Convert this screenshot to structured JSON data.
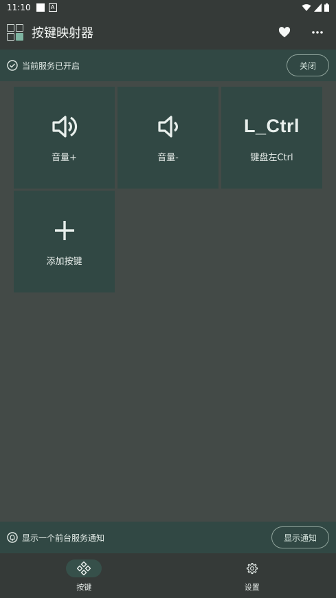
{
  "status": {
    "time": "11:10",
    "notification_letter": "A"
  },
  "app": {
    "title": "按键映射器",
    "icons": {
      "logo": "app-logo-icon",
      "favorite": "heart-icon",
      "more": "more-horiz-icon"
    }
  },
  "service": {
    "status_text": "当前服务已开启",
    "close_label": "关闭",
    "icon": "check-circle-icon"
  },
  "keys": [
    {
      "icon": "volume-up-icon",
      "label": "音量+"
    },
    {
      "icon": "volume-down-icon",
      "label": "音量-"
    },
    {
      "icon_text": "L_Ctrl",
      "label": "键盘左Ctrl"
    },
    {
      "icon": "plus-icon",
      "label": "添加按键"
    }
  ],
  "notification": {
    "text": "显示一个前台服务通知",
    "button_label": "显示通知",
    "icon": "bell-icon"
  },
  "nav": {
    "items": [
      {
        "label": "按键",
        "icon": "gamepad-icon",
        "active": true
      },
      {
        "label": "设置",
        "icon": "gear-icon",
        "active": false
      }
    ]
  },
  "colors": {
    "background": "#434a47",
    "bar": "#353a38",
    "accent_surface": "#314844",
    "active_pill": "#36504a"
  }
}
